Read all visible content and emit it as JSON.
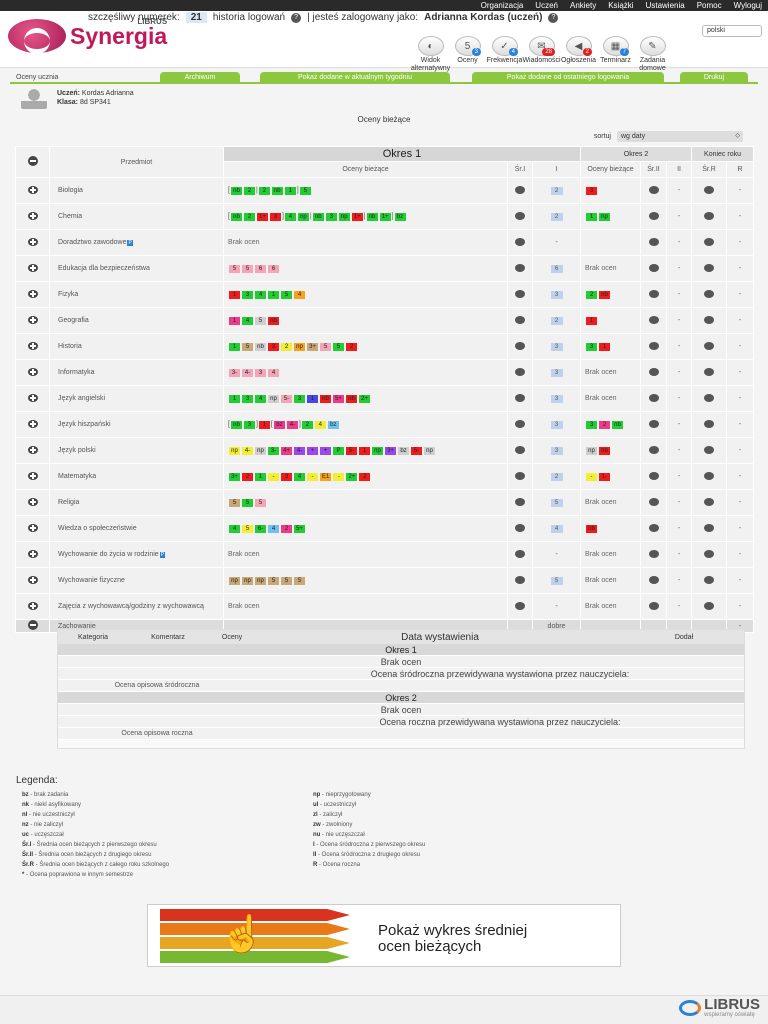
{
  "topnav": [
    "Organizacja",
    "Uczeń",
    "Ankiety",
    "Książki",
    "Ustawienia",
    "Pomoc",
    "Wyloguj"
  ],
  "logo": {
    "sup": "LIBRUS",
    "text": "Synergia"
  },
  "status": {
    "lucky_label": "szczęśliwy numerek:",
    "lucky_value": "21",
    "history": "historia logowań",
    "logged_label": "| jesteś zalogowany jako:",
    "user": "Adrianna Kordas (uczeń)",
    "lang": "polski"
  },
  "iconnav": [
    {
      "label": "Widok alternatywny",
      "glyph": "◐",
      "badge": ""
    },
    {
      "label": "Oceny",
      "glyph": "5",
      "badge": "3"
    },
    {
      "label": "Frekwencja",
      "glyph": "✓",
      "badge": "4"
    },
    {
      "label": "Wiadomości",
      "glyph": "✉",
      "badge": "28"
    },
    {
      "label": "Ogłoszenia",
      "glyph": "◀",
      "badge": "2"
    },
    {
      "label": "Terminarz",
      "glyph": "▦",
      "badge": "7"
    },
    {
      "label": "Zadania domowe",
      "glyph": "✎",
      "badge": ""
    }
  ],
  "colors": {
    "accent": "#8dc63f",
    "brand": "#c2185b",
    "badge": "#2a82d9",
    "red": "#dd2222",
    "green": "#22cc22",
    "blue_avg": "#bdd1ec"
  },
  "subnav": {
    "crumb": "Oceny ucznia",
    "archive": "Archiwum",
    "week": "Pokaż dodane w aktualnym tygodniu",
    "since": "Pokaż dodane od ostatniego logowania",
    "print": "Drukuj"
  },
  "student": {
    "name_label": "Uczeń:",
    "name": "Kordas Adrianna",
    "class_label": "Klasa:",
    "class": "8d SP341"
  },
  "page_title": "Oceny bieżące",
  "sort": {
    "label": "sortuj",
    "value": "wg daty"
  },
  "table_head": {
    "subject": "Przedmiot",
    "okres1": "Okres 1",
    "okres2": "Okres 2",
    "year_end": "Koniec roku",
    "current": "Oceny bieżące",
    "sr1": "Śr.I",
    "i": "I",
    "current2": "Oceny bieżące",
    "sr2": "Śr.II",
    "ii": "II",
    "srr": "Śr.R",
    "r": "R"
  },
  "subjects": [
    {
      "name": "Biologia",
      "g1": [
        [
          "[",
          "b"
        ],
        [
          "nb",
          "gn"
        ],
        [
          "2",
          "gn"
        ],
        [
          "|",
          "b"
        ],
        [
          "2",
          "gn"
        ],
        [
          "nb",
          "gn"
        ],
        [
          "1",
          "gn"
        ],
        [
          "]",
          "b"
        ],
        [
          "5",
          "gn"
        ]
      ],
      "sr1": "",
      "i": "2",
      "g2": [
        [
          "3",
          "rd"
        ]
      ],
      "sr2": "",
      "ii": "-",
      "srr": "",
      "r": "-"
    },
    {
      "name": "Chemia",
      "g1": [
        [
          "[",
          "b"
        ],
        [
          "nb",
          "gn"
        ],
        [
          "2",
          "gn"
        ],
        [
          "1+",
          "rd"
        ],
        [
          "3",
          "rd"
        ],
        [
          "]",
          "b"
        ],
        [
          "4",
          "gn"
        ],
        [
          "np",
          "gn"
        ],
        [
          "|",
          "b"
        ],
        [
          "nb",
          "gn"
        ],
        [
          "3",
          "gn"
        ],
        [
          "np",
          "gn"
        ],
        [
          "1+",
          "rd"
        ],
        [
          "|",
          "b"
        ],
        [
          "nb",
          "gn"
        ],
        [
          "1+",
          "gn"
        ],
        [
          "]",
          "b"
        ],
        [
          "bz",
          "gn"
        ]
      ],
      "sr1": "",
      "i": "2",
      "g2": [
        [
          "1",
          "gn"
        ],
        [
          "np",
          "gn"
        ]
      ],
      "sr2": "",
      "ii": "-",
      "srr": "",
      "r": "-"
    },
    {
      "name": "Doradztwo zawodowe",
      "badge": "P",
      "empty1": "Brak ocen",
      "sr1": "",
      "i": "-",
      "g2": [],
      "sr2": "",
      "ii": "-",
      "srr": "",
      "r": "-"
    },
    {
      "name": "Edukacja dla bezpieczeństwa",
      "g1": [
        [
          "5",
          "pk"
        ],
        [
          "5",
          "pk"
        ],
        [
          "6",
          "pk"
        ],
        [
          "6",
          "pk"
        ]
      ],
      "sr1": "",
      "i": "6",
      "empty2": "Brak ocen",
      "sr2": "",
      "ii": "-",
      "srr": "",
      "r": "-"
    },
    {
      "name": "Fizyka",
      "g1": [
        [
          "1",
          "rd"
        ],
        [
          "3",
          "gn"
        ],
        [
          "4",
          "gn"
        ],
        [
          "1",
          "gn"
        ],
        [
          "5",
          "gn"
        ],
        [
          "4",
          "or"
        ]
      ],
      "sr1": "",
      "i": "3",
      "g2": [
        [
          "2",
          "gn"
        ],
        [
          "nb",
          "rd"
        ]
      ],
      "sr2": "",
      "ii": "-",
      "srr": "",
      "r": "-"
    },
    {
      "name": "Geografia",
      "g1": [
        [
          "1",
          "mg"
        ],
        [
          "4",
          "gn"
        ],
        [
          "5",
          "lg"
        ],
        [
          "nb",
          "rd"
        ]
      ],
      "sr1": "",
      "i": "2",
      "g2": [
        [
          "1",
          "rd"
        ]
      ],
      "sr2": "",
      "ii": "-",
      "srr": "",
      "r": "-"
    },
    {
      "name": "Historia",
      "g1": [
        [
          "1",
          "gn"
        ],
        [
          "5",
          "tn"
        ],
        [
          "nb",
          "lg"
        ],
        [
          "3",
          "rd"
        ],
        [
          "2",
          "ye"
        ],
        [
          "np",
          "or"
        ],
        [
          "3+",
          "tn"
        ],
        [
          "5",
          "pk"
        ],
        [
          "5",
          "gn"
        ],
        [
          "2",
          "rd"
        ]
      ],
      "sr1": "",
      "i": "3",
      "g2": [
        [
          "3",
          "gn"
        ],
        [
          "1",
          "rd"
        ]
      ],
      "sr2": "",
      "ii": "-",
      "srr": "",
      "r": "-"
    },
    {
      "name": "Informatyka",
      "g1": [
        [
          "3-",
          "pk"
        ],
        [
          "4-",
          "pk"
        ],
        [
          "3",
          "pk"
        ],
        [
          "4",
          "pk"
        ]
      ],
      "sr1": "",
      "i": "3",
      "empty2": "Brak ocen",
      "sr2": "",
      "ii": "-",
      "srr": "",
      "r": "-"
    },
    {
      "name": "Język angielski",
      "g1": [
        [
          "1",
          "gn"
        ],
        [
          "3",
          "gn"
        ],
        [
          "4",
          "gn"
        ],
        [
          "np",
          "lg"
        ],
        [
          "5-",
          "pk"
        ],
        [
          "3",
          "gn"
        ],
        [
          "1",
          "bl"
        ],
        [
          "nb",
          "rd"
        ],
        [
          "5+",
          "mg"
        ],
        [
          "nb",
          "rd"
        ],
        [
          "2+",
          "gn"
        ]
      ],
      "sr1": "",
      "i": "3",
      "empty2": "Brak ocen",
      "sr2": "",
      "ii": "-",
      "srr": "",
      "r": "-"
    },
    {
      "name": "Język hiszpański",
      "g1": [
        [
          "[",
          "b"
        ],
        [
          "nb",
          "gn"
        ],
        [
          "3",
          "gn"
        ],
        [
          "]",
          "b"
        ],
        [
          "1",
          "rd"
        ],
        [
          "[",
          "b"
        ],
        [
          "bz",
          "mg"
        ],
        [
          "4-",
          "mg"
        ],
        [
          "]",
          "b"
        ],
        [
          "2",
          "gn"
        ],
        [
          "4",
          "ye"
        ],
        [
          "bz",
          "lb"
        ]
      ],
      "sr1": "",
      "i": "3",
      "g2": [
        [
          "3",
          "gn"
        ],
        [
          "2",
          "mg"
        ],
        [
          "nb",
          "gn"
        ]
      ],
      "sr2": "",
      "ii": "-",
      "srr": "",
      "r": "-"
    },
    {
      "name": "Język polski",
      "g1": [
        [
          "np",
          "ye"
        ],
        [
          "4-",
          "ye"
        ],
        [
          "np",
          "lg"
        ],
        [
          "3-",
          "gn"
        ],
        [
          "4+",
          "mg"
        ],
        [
          "4-",
          "pu"
        ],
        [
          "+",
          "pu"
        ],
        [
          "+",
          "pu"
        ],
        [
          "P",
          "gn"
        ],
        [
          "5-",
          "rd"
        ],
        [
          "1",
          "rd"
        ],
        [
          "np",
          "gn"
        ],
        [
          "3+",
          "pu"
        ],
        [
          "bz",
          "lg"
        ],
        [
          "5-",
          "rd"
        ],
        [
          "np",
          "lg"
        ]
      ],
      "sr1": "",
      "i": "3",
      "g2": [
        [
          "np",
          "lg"
        ],
        [
          "nb",
          "rd"
        ]
      ],
      "sr2": "",
      "ii": "-",
      "srr": "",
      "r": "-"
    },
    {
      "name": "Matematyka",
      "g1": [
        [
          "3+",
          "gn"
        ],
        [
          "2",
          "rd"
        ],
        [
          "1",
          "gn"
        ],
        [
          "-",
          "ye"
        ],
        [
          "3",
          "rd"
        ],
        [
          "4",
          "gn"
        ],
        [
          "-",
          "ye"
        ],
        [
          "E1",
          "or"
        ],
        [
          "-",
          "ye"
        ],
        [
          "2+",
          "gn"
        ],
        [
          "2",
          "rd"
        ]
      ],
      "sr1": "",
      "i": "2",
      "g2": [
        [
          "-",
          "ye"
        ],
        [
          "1-",
          "rd"
        ]
      ],
      "sr2": "",
      "ii": "-",
      "srr": "",
      "r": "-"
    },
    {
      "name": "Religia",
      "g1": [
        [
          "5",
          "tn"
        ],
        [
          "5",
          "gn"
        ],
        [
          "5",
          "pk"
        ]
      ],
      "sr1": "",
      "i": "5",
      "empty2": "Brak ocen",
      "sr2": "",
      "ii": "-",
      "srr": "",
      "r": "-"
    },
    {
      "name": "Wiedza o społeczeństwie",
      "g1": [
        [
          "4",
          "gn"
        ],
        [
          "5",
          "ye"
        ],
        [
          "6-",
          "gn"
        ],
        [
          "4",
          "lb"
        ],
        [
          "2",
          "mg"
        ],
        [
          "5+",
          "gn"
        ]
      ],
      "sr1": "",
      "i": "4",
      "g2": [
        [
          "nb",
          "rd"
        ]
      ],
      "sr2": "",
      "ii": "-",
      "srr": "",
      "r": "-"
    },
    {
      "name": "Wychowanie do życia w rodzinie",
      "badge": "P",
      "empty1": "Brak ocen",
      "sr1": "",
      "i": "-",
      "empty2": "Brak ocen",
      "sr2": "",
      "ii": "-",
      "srr": "",
      "r": "-"
    },
    {
      "name": "Wychowanie fizyczne",
      "g1": [
        [
          "np",
          "tn"
        ],
        [
          "np",
          "tn"
        ],
        [
          "np",
          "tn"
        ],
        [
          "5",
          "tn"
        ],
        [
          "5",
          "tn"
        ],
        [
          "5",
          "tn"
        ]
      ],
      "sr1": "",
      "i": "5",
      "empty2": "Brak ocen",
      "sr2": "",
      "ii": "-",
      "srr": "",
      "r": "-"
    },
    {
      "name": "Zajęcia z wychowawcą/godziny z wychowawcą",
      "empty1": "Brak ocen",
      "sr1": "",
      "i": "-",
      "empty2": "Brak ocen",
      "sr2": "",
      "ii": "-",
      "srr": "",
      "r": "-"
    }
  ],
  "behaviour": {
    "label": "Zachowanie",
    "i": "dobre",
    "r": "-"
  },
  "beh_panel": {
    "category": "Kategoria",
    "comment": "Komentarz",
    "grades": "Oceny",
    "date": "Data wystawienia",
    "added": "Dodał",
    "okres1": "Okres 1",
    "no1": "Brak ocen",
    "desc1_label": "Ocena opisowa śródroczna",
    "desc1": "Ocena śródroczna przewidywana wystawiona przez nauczyciela:",
    "okres2": "Okres 2",
    "no2": "Brak ocen",
    "desc2_label": "Ocena opisowa roczna",
    "desc2": "Ocena roczna przewidywana wystawiona przez nauczyciela:"
  },
  "legend": {
    "title": "Legenda:",
    "left": [
      [
        "bz",
        "- brak zadania"
      ],
      [
        "nk",
        "- niekl asyfikowany"
      ],
      [
        "nl",
        "- nie uczestniczył"
      ],
      [
        "nz",
        "- nie zaliczył"
      ],
      [
        "uc",
        "- uczęszczał"
      ],
      [
        "Śr.I",
        "- Średnia ocen bieżących z pierwszego okresu"
      ],
      [
        "Śr.II",
        "- Średnia ocen bieżących z drugiego okresu"
      ],
      [
        "Śr.R",
        "- Średnia ocen bieżących z całego roku szkolnego"
      ],
      [
        "*",
        "- Ocena poprawiona w innym semestrze"
      ]
    ],
    "right": [
      [
        "np",
        "- nieprzygotowany"
      ],
      [
        "ul",
        "- uczestniczył"
      ],
      [
        "zl",
        "- zaliczył"
      ],
      [
        "zw",
        "- zwolniony"
      ],
      [
        "nu",
        "- nie uczęszczał"
      ],
      [
        "I",
        "- Ocena śródroczna z pierwszego okresu"
      ],
      [
        "II",
        "- Ocena śródroczna z drugiego okresu"
      ],
      [
        "R",
        "- Ocena roczna"
      ]
    ]
  },
  "banner": {
    "line1": "Pokaż wykres średniej",
    "line2": "ocen bieżących"
  },
  "footer": {
    "logo": "LIBRUS",
    "tagline": "wspieramy oświatę"
  }
}
